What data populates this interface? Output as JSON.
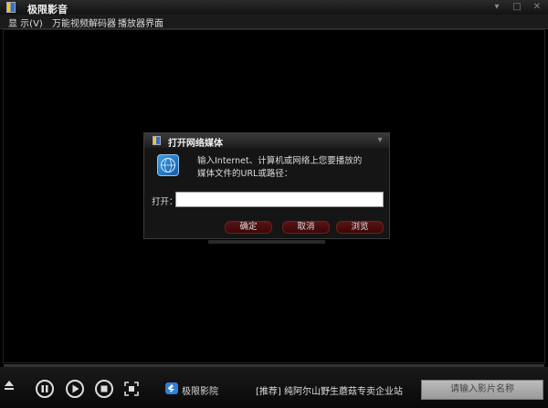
{
  "window": {
    "title": "极限影音"
  },
  "menu": {
    "items": [
      "显 示(V)",
      "万能视频解码器",
      "播放器界面"
    ]
  },
  "dialog": {
    "title": "打开网络媒体",
    "message_line1": "输入Internet、计算机或网络上您要播放的",
    "message_line2": "媒体文件的URL或路径：",
    "open_label": "打开：",
    "input_value": "",
    "ok_label": "确定",
    "cancel_label": "取消",
    "browse_label": "浏览"
  },
  "controls": {
    "brand": "极限影院",
    "promo": "[推荐] 纯阿尔山野生蘑菇专卖企业站",
    "search_placeholder": "请输入影片名称",
    "progress": 0
  },
  "colors": {
    "accent_red": "#5a1414",
    "brand_blue": "#2f7fd6"
  }
}
